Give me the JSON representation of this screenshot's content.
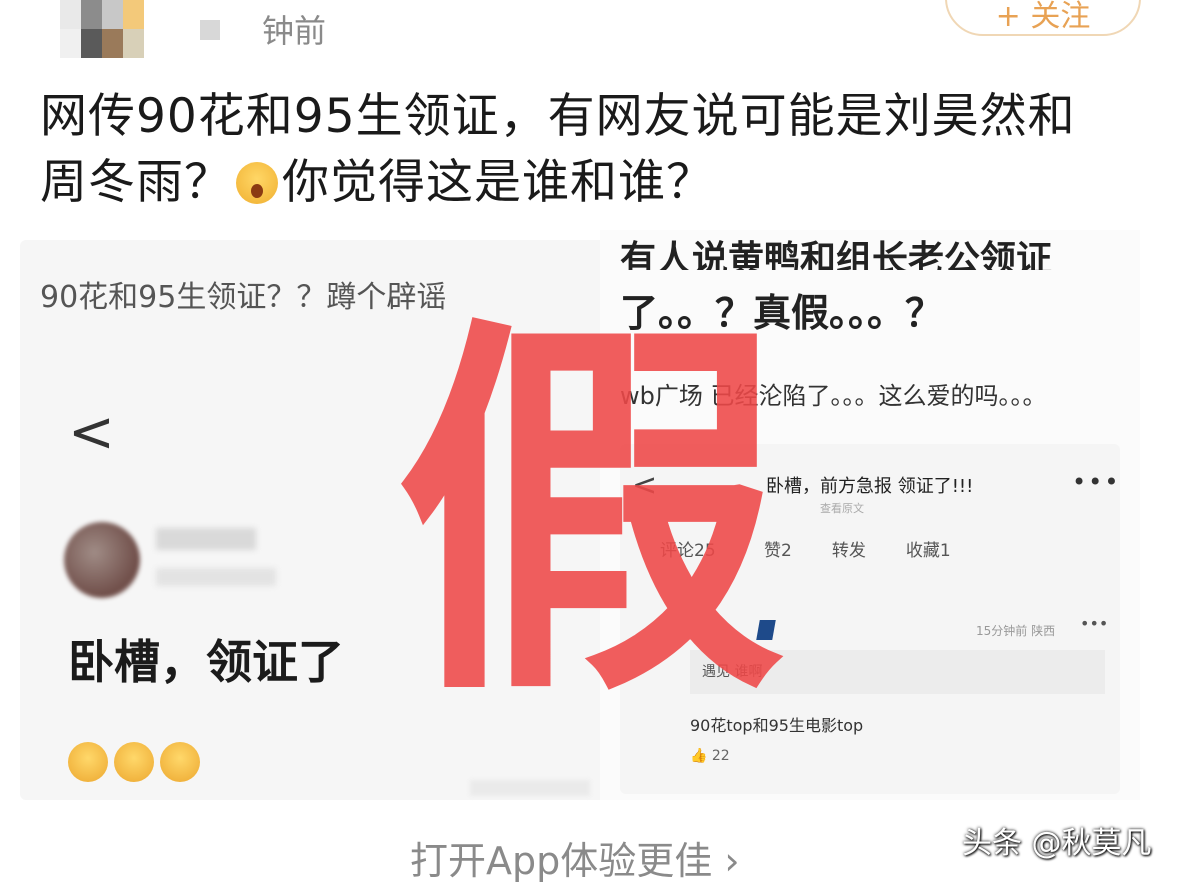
{
  "header": {
    "time_suffix": "钟前",
    "follow_label": "+ 关注"
  },
  "post": {
    "line1": "网传90花和95生领证，有网友说可能是刘昊然和",
    "line2_a": "周冬雨？",
    "line2_b": "你觉得这是谁和谁？",
    "emoji_icon": "shocked-face-icon"
  },
  "collage": {
    "left": {
      "title": "90花和95生领证？？蹲个辟谣",
      "back": "<",
      "big_text": "卧槽，领证了"
    },
    "right": {
      "line1": "有人说黄鸭和组长老公领证",
      "line2": "了。。？真假。。。？",
      "line3": "wb广场 已经沦陷了。。。这么爱的吗。。。",
      "card": {
        "back": "<",
        "title": "卧槽，前方急报 领证了!!!",
        "subtitle": "查看原文",
        "more": "•••",
        "tab_first": "评论25",
        "tabs": [
          "赞2",
          "转发",
          "收藏1"
        ],
        "time": "15分钟前 陕西",
        "dots": "•••",
        "quote": "遇见 谁啊",
        "body": "90花top和95生电影top",
        "likes": "22"
      }
    },
    "overlay": "假"
  },
  "footer": {
    "open_app": "打开App体验更佳 ›",
    "watermark": "头条 @秋莫凡"
  },
  "colors": {
    "overlay_red": "#ef4848",
    "follow_accent": "#e8a254"
  }
}
